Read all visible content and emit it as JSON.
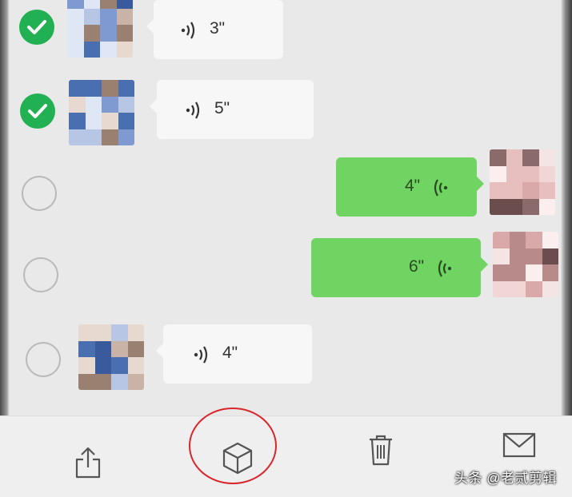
{
  "messages": [
    {
      "direction": "in",
      "selected": true,
      "duration": "3\""
    },
    {
      "direction": "in",
      "selected": true,
      "duration": "5\""
    },
    {
      "direction": "out",
      "selected": false,
      "duration": "4\""
    },
    {
      "direction": "out",
      "selected": false,
      "duration": "6\""
    },
    {
      "direction": "in",
      "selected": false,
      "duration": "4\""
    }
  ],
  "toolbar": {
    "items": [
      {
        "icon": "share-icon"
      },
      {
        "icon": "cube-icon",
        "highlighted": true
      },
      {
        "icon": "trash-icon"
      },
      {
        "icon": "mail-icon"
      }
    ]
  },
  "colors": {
    "check_green": "#21b152",
    "outgoing_bubble": "#6fd461",
    "incoming_bubble": "#f7f7f7",
    "highlight_red": "#d8262b"
  },
  "watermark": "头条 @老贰剪辑"
}
